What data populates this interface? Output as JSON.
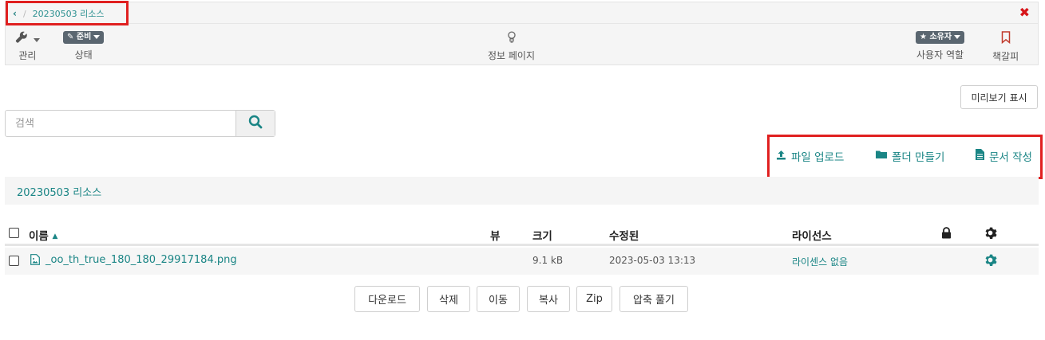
{
  "breadcrumb": {
    "back_icon": "chevron-left-icon",
    "separator": "/",
    "current": "20230503 리소스"
  },
  "close_icon": "close-x-icon",
  "toolbar": {
    "manage_label": "관리",
    "status_badge": "준비",
    "status_label": "상태",
    "info_label": "정보 페이지",
    "owner_badge": "소유자",
    "role_label": "사용자 역할",
    "bookmark_label": "책갈피"
  },
  "preview_button": "미리보기 표시",
  "search": {
    "placeholder": "검색",
    "value": ""
  },
  "actions": {
    "upload": "파일 업로드",
    "new_folder": "폴더 만들기",
    "write_doc": "문서 작성"
  },
  "folder_title": "20230503 리소스",
  "table": {
    "columns": {
      "name": "이름",
      "view": "뷰",
      "size": "크기",
      "modified": "수정된",
      "license": "라이선스"
    },
    "rows": [
      {
        "name": "_oo_th_true_180_180_29917184.png",
        "view": "",
        "size": "9.1 kB",
        "modified": "2023-05-03 13:13",
        "license": "라이센스 없음"
      }
    ]
  },
  "bulk_actions": {
    "download": "다운로드",
    "delete": "삭제",
    "move": "이동",
    "copy": "복사",
    "zip": "Zip",
    "unzip": "압축 풀기"
  },
  "colors": {
    "accent": "#1a8585",
    "close": "#d7161b",
    "highlight_box": "#e02020",
    "badge": "#5a6670"
  }
}
